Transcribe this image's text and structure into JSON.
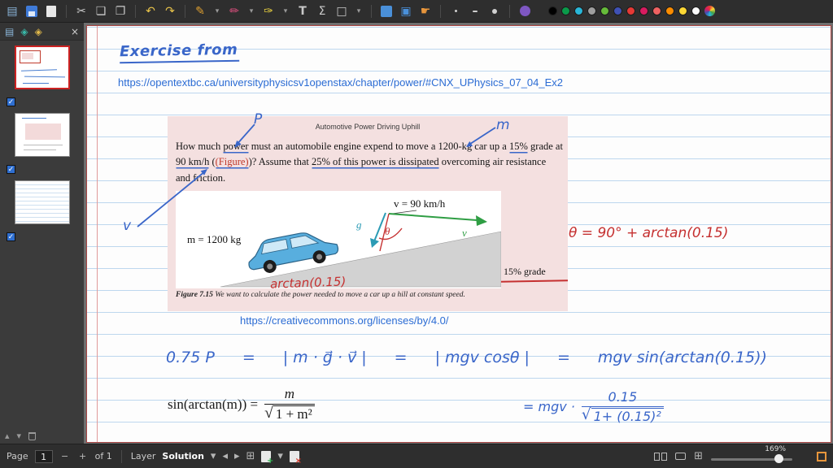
{
  "icons": {
    "menu": "▤",
    "scissors": "✂",
    "copy": "❏",
    "paste": "❐",
    "undo": "↶",
    "redo": "↷",
    "pen": "✎",
    "highlighter": "✏",
    "marker": "✑",
    "caret": "▾",
    "image": "▣",
    "hand": "☛",
    "check": "✓",
    "close": "×",
    "pages_tab": "▤",
    "layers_tab": "◈",
    "grid": "⊞",
    "prev": "◂",
    "next": "▸",
    "minus": "−",
    "plus": "+",
    "up": "▴",
    "down": "▾"
  },
  "toolbar": {
    "text_tool": "T",
    "math_tool": "Σ",
    "shape_tool": "□",
    "active_color": "#7e57c2",
    "pen_colors": [
      "#000000",
      "#0a9a4a",
      "#29b6d8",
      "#9e9e9e",
      "#66bb3a",
      "#3f51b5",
      "#e53935",
      "#d81b60",
      "#ef6262",
      "#fb8c00",
      "#fdd835",
      "#fafafa"
    ]
  },
  "statusbar": {
    "page_label": "Page",
    "page_value": "1",
    "of_label": "of 1",
    "layer_label": "Layer",
    "layer_value": "Solution",
    "zoom_value": "169%"
  },
  "note": {
    "heading": "Exercise from",
    "source_url": "https://opentextbc.ca/universityphysicsv1openstax/chapter/power/#CNX_UPhysics_07_04_Ex2",
    "license_url": "https://creativecommons.org/licenses/by/4.0/",
    "label_p": "P",
    "label_m": "m",
    "label_v": "v",
    "theta_equation": "θ = 90° + arctan(0.15)",
    "work": {
      "t0": "0.75 P",
      "eq": "=",
      "t1": "| m · g⃗ · v⃗ |",
      "t2": "| mgv cosθ |",
      "t3": "mgv sin(arctan(0.15))"
    },
    "identity": {
      "lhs": "sin(arctan(m)) =",
      "num": "m",
      "radical": "√",
      "den": "1 + m²"
    },
    "final": {
      "prefix": "= mgv ·",
      "num": "0.15",
      "radical": "√",
      "den": "1+ (0.15)²"
    }
  },
  "problem": {
    "title": "Automotive Power Driving Uphill",
    "segments": [
      "How much ",
      "power",
      " must an automobile engine expend to move a 1200-kg car up a ",
      "15%",
      " grade at ",
      "90 km/h",
      " (",
      "(Figure)",
      ")? Assume that ",
      "25% of this power is dissipated",
      " overcoming air resistance and friction."
    ],
    "figure": {
      "mass": "m = 1200 kg",
      "speed": "v = 90 km/h",
      "grade": "15% grade",
      "g_vec": "g⃗",
      "v_vec": "v⃗",
      "theta": "θ",
      "arctan_note": "arctan(0.15)",
      "caption_label": "Figure 7.15",
      "caption_text": " We want to calculate the power needed to move a car up a hill at constant speed."
    }
  }
}
